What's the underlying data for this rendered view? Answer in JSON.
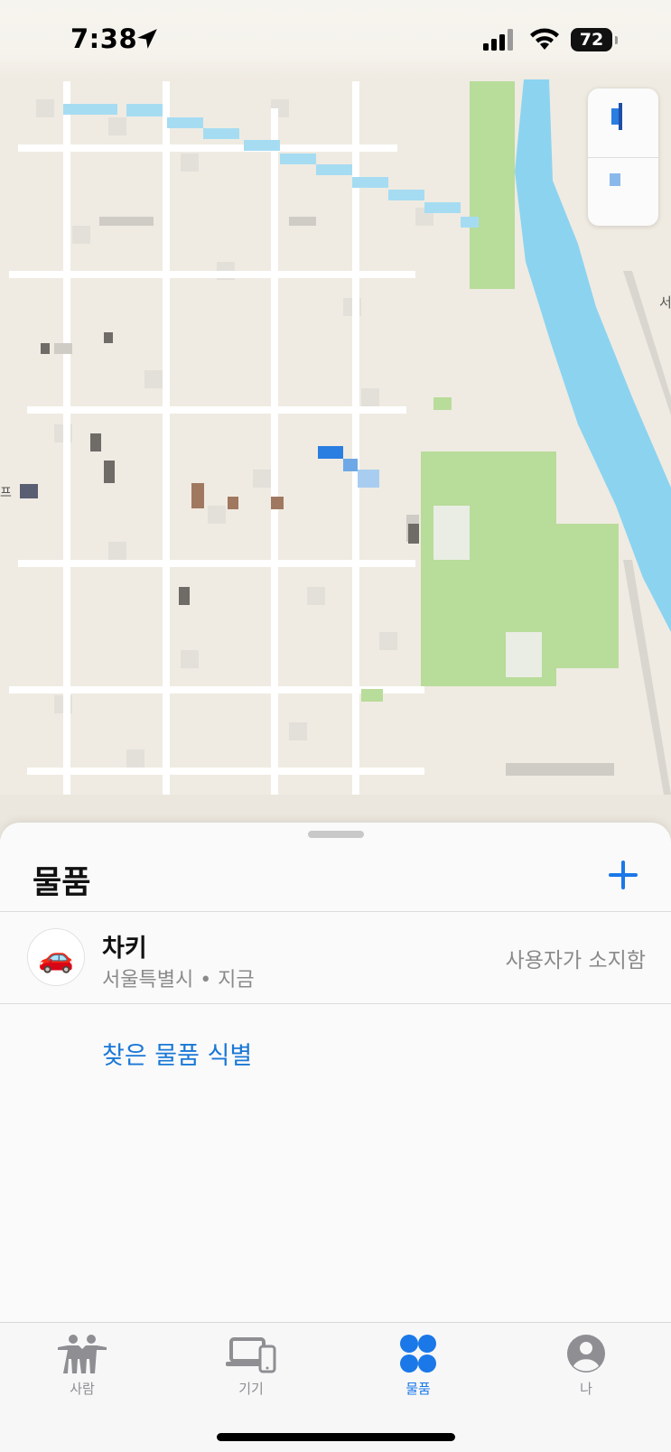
{
  "status_bar": {
    "time": "7:38",
    "battery": "72"
  },
  "sheet": {
    "title": "물품",
    "add_icon": "plus-icon",
    "items": [
      {
        "emoji": "🚗",
        "name": "차키",
        "location": "서울특별시",
        "time": "지금",
        "status": "사용자가 소지함"
      }
    ],
    "identify_link": "찾은 물품 식별"
  },
  "map": {
    "visible_labels": [
      "서",
      "프"
    ]
  },
  "tabbar": {
    "tabs": [
      {
        "label": "사람",
        "icon": "people-icon",
        "active": false
      },
      {
        "label": "기기",
        "icon": "devices-icon",
        "active": false
      },
      {
        "label": "물품",
        "icon": "items-icon",
        "active": true
      },
      {
        "label": "나",
        "icon": "me-icon",
        "active": false
      }
    ]
  },
  "colors": {
    "accent": "#1a78e8",
    "river": "#8cd3f0",
    "park": "#b8dc9a",
    "map_bg": "#efebe2"
  }
}
